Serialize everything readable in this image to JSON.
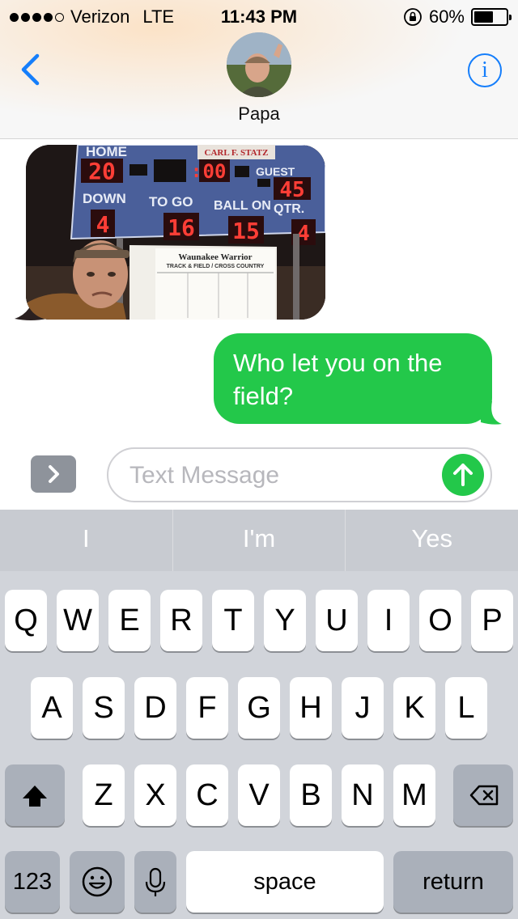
{
  "status_bar": {
    "carrier": "Verizon",
    "network": "LTE",
    "time": "11:43 PM",
    "battery": "60%",
    "battery_fraction": 0.6,
    "signal_bars_filled": 4,
    "signal_bars_total": 5
  },
  "header": {
    "contact_name": "Papa",
    "back_icon": "chevron-left-icon",
    "info_icon": "info-icon",
    "info_glyph": "i"
  },
  "messages": {
    "incoming_photo": {
      "scoreboard": {
        "home_label": "HOME",
        "home_score": "20",
        "clock": "00",
        "guest_label": "GUEST",
        "guest_score": "45",
        "down_label": "DOWN",
        "down_value": "4",
        "to_go_label": "TO GO",
        "to_go_value": "16",
        "ball_on_label": "BALL ON",
        "ball_on_value": "15",
        "qtr_label": "QTR.",
        "qtr_value": "4",
        "sponsor": "CARL F. STATZ",
        "banner_title": "Waunakee Warrior",
        "banner_subtitle": "TRACK & FIELD / CROSS COUNTRY"
      }
    },
    "outgoing_text": "Who let you on the field?"
  },
  "compose": {
    "placeholder": "Text Message",
    "value": "",
    "expand_icon": "chevron-right-icon",
    "send_icon": "arrow-up-icon"
  },
  "keyboard": {
    "predictions": [
      "I",
      "I'm",
      "Yes"
    ],
    "row1": [
      "Q",
      "W",
      "E",
      "R",
      "T",
      "Y",
      "U",
      "I",
      "O",
      "P"
    ],
    "row2": [
      "A",
      "S",
      "D",
      "F",
      "G",
      "H",
      "J",
      "K",
      "L"
    ],
    "row3": [
      "Z",
      "X",
      "C",
      "V",
      "B",
      "N",
      "M"
    ],
    "numbers_label": "123",
    "space_label": "space",
    "return_label": "return",
    "shift_icon": "shift-icon",
    "delete_icon": "delete-icon",
    "emoji_icon": "emoji-icon",
    "mic_icon": "microphone-icon"
  },
  "colors": {
    "accent": "#157efb",
    "sent_bubble": "#23c84a",
    "keyboard_bg": "#d1d4da"
  }
}
